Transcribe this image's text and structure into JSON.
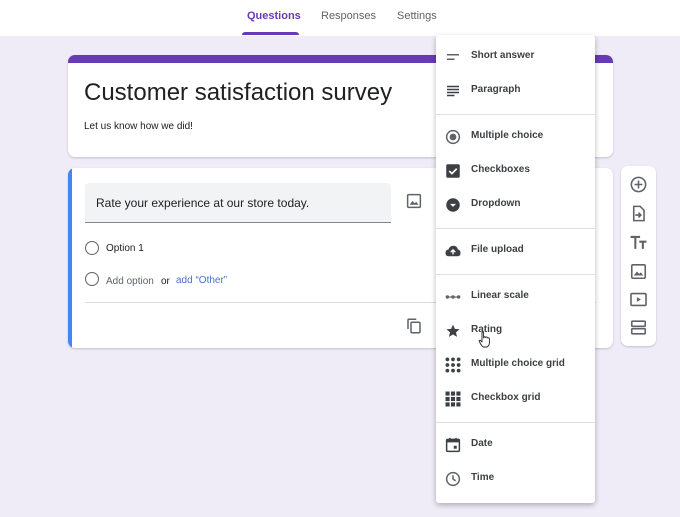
{
  "tabs": [
    {
      "label": "Questions",
      "active": true
    },
    {
      "label": "Responses",
      "active": false
    },
    {
      "label": "Settings",
      "active": false
    }
  ],
  "colors": {
    "accent": "#673ab7",
    "focus": "#4285f4",
    "link": "#4a6fd1",
    "background": "#efebf7"
  },
  "form": {
    "title": "Customer satisfaction survey",
    "description": "Let us know how we did!"
  },
  "question": {
    "text": "Rate your experience at our store today.",
    "options": [
      "Option 1"
    ],
    "add_option": "Add option",
    "or": "or",
    "add_other": "add “Other”"
  },
  "side_toolbar": [
    "add-question-icon",
    "import-questions-icon",
    "add-title-icon",
    "add-image-icon",
    "add-video-icon",
    "add-section-icon"
  ],
  "type_menu": {
    "items": [
      {
        "label": "Short answer",
        "icon": "short-answer-icon"
      },
      {
        "label": "Paragraph",
        "icon": "paragraph-icon"
      },
      {
        "label": "Multiple choice",
        "icon": "radio-icon"
      },
      {
        "label": "Checkboxes",
        "icon": "checkbox-icon"
      },
      {
        "label": "Dropdown",
        "icon": "dropdown-icon"
      },
      {
        "label": "File upload",
        "icon": "cloud-upload-icon"
      },
      {
        "label": "Linear scale",
        "icon": "linear-scale-icon"
      },
      {
        "label": "Rating",
        "icon": "star-icon"
      },
      {
        "label": "Multiple choice grid",
        "icon": "grid-icon"
      },
      {
        "label": "Checkbox grid",
        "icon": "grid-icon"
      },
      {
        "label": "Date",
        "icon": "calendar-icon"
      },
      {
        "label": "Time",
        "icon": "clock-icon"
      }
    ]
  }
}
